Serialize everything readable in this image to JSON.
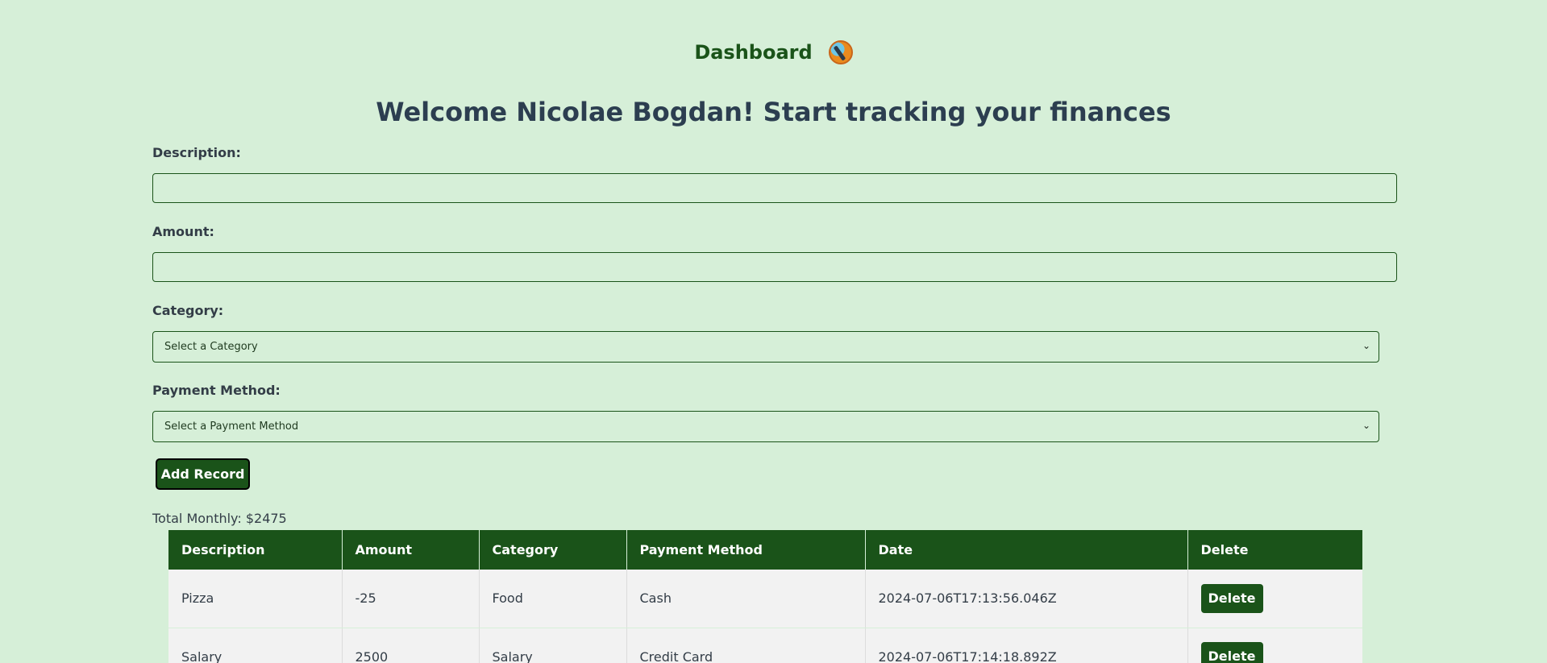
{
  "header": {
    "title": "Dashboard",
    "avatar_icon": "avatar-icon"
  },
  "welcome": "Welcome Nicolae Bogdan! Start tracking your finances",
  "form": {
    "description_label": "Description:",
    "description_value": "",
    "amount_label": "Amount:",
    "amount_value": "",
    "category_label": "Category:",
    "category_selected": "Select a Category",
    "payment_label": "Payment Method:",
    "payment_selected": "Select a Payment Method",
    "add_button": "Add Record"
  },
  "total": "Total Monthly: $2475",
  "table": {
    "headers": [
      "Description",
      "Amount",
      "Category",
      "Payment Method",
      "Date",
      "Delete"
    ],
    "rows": [
      {
        "description": "Pizza",
        "amount": "-25",
        "category": "Food",
        "payment": "Cash",
        "date": "2024-07-06T17:13:56.046Z",
        "delete": "Delete"
      },
      {
        "description": "Salary",
        "amount": "2500",
        "category": "Salary",
        "payment": "Credit Card",
        "date": "2024-07-06T17:14:18.892Z",
        "delete": "Delete"
      }
    ]
  },
  "colors": {
    "background": "#d6efd8",
    "accent": "#1a5319",
    "row": "#f2f2f2",
    "heading": "#2c3e50"
  }
}
